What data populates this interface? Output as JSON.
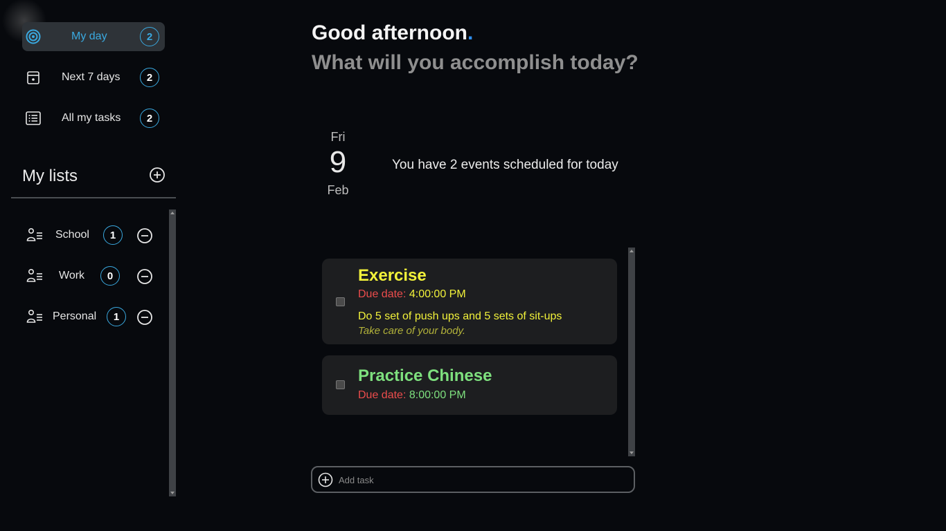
{
  "nav": [
    {
      "label": "My day",
      "count": "2",
      "icon": "target-icon"
    },
    {
      "label": "Next 7 days",
      "count": "2",
      "icon": "calendar-icon"
    },
    {
      "label": "All my tasks",
      "count": "2",
      "icon": "list-icon"
    }
  ],
  "lists": {
    "title": "My lists",
    "items": [
      {
        "label": "School",
        "count": "1",
        "icon": "user-list-icon"
      },
      {
        "label": "Work",
        "count": "0",
        "icon": "user-list-icon"
      },
      {
        "label": "Personal",
        "count": "1",
        "icon": "user-list-icon"
      }
    ]
  },
  "header": {
    "greeting": "Good afternoon",
    "greeting_dot": ".",
    "subtitle": "What will you accomplish today?"
  },
  "date": {
    "weekday": "Fri",
    "day": "9",
    "month": "Feb"
  },
  "summary": "You have 2 events scheduled for today",
  "tasks": [
    {
      "title": "Exercise",
      "due_label": "Due date:",
      "due_time": "4:00:00 PM",
      "description": "Do 5 set of push ups and 5 sets of sit-ups",
      "note": "Take care of your body.",
      "color": "#f2f23a",
      "note_color": "#b2b23a"
    },
    {
      "title": "Practice Chinese",
      "due_label": "Due date:",
      "due_time": "8:00:00 PM",
      "color": "#7ee07e"
    }
  ],
  "add_task": {
    "placeholder": "Add task"
  },
  "colors": {
    "accent": "#3aa9e0",
    "background": "#07090d",
    "card": "#1d1e20",
    "due_label": "#ec4c4c"
  }
}
